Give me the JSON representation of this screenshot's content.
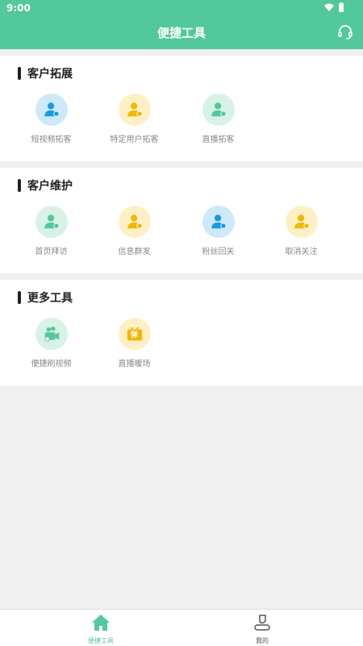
{
  "status_bar": {
    "time": "9:00"
  },
  "header": {
    "title": "便捷工具"
  },
  "sections": [
    {
      "title": "客户拓展",
      "items": [
        {
          "label": "短视频拓客",
          "icon": "user-video-icon",
          "color": "#1a9be0",
          "bg": "#cfe9f8"
        },
        {
          "label": "特定用户拓客",
          "icon": "user-search-icon",
          "color": "#f2b705",
          "bg": "#fdf0c4"
        },
        {
          "label": "直播拓客",
          "icon": "user-live-icon",
          "color": "#52c89c",
          "bg": "#d8f2e8"
        }
      ]
    },
    {
      "title": "客户维护",
      "items": [
        {
          "label": "首页拜访",
          "icon": "user-home-icon",
          "color": "#52c89c",
          "bg": "#d8f2e8"
        },
        {
          "label": "信息群发",
          "icon": "user-message-icon",
          "color": "#f2b705",
          "bg": "#fdf0c4"
        },
        {
          "label": "粉丝回关",
          "icon": "user-follow-icon",
          "color": "#1a9be0",
          "bg": "#cfe9f8"
        },
        {
          "label": "取消关注",
          "icon": "user-unfollow-icon",
          "color": "#f2b705",
          "bg": "#fdf0c4"
        }
      ]
    },
    {
      "title": "更多工具",
      "items": [
        {
          "label": "便捷刷视频",
          "icon": "video-camera-icon",
          "color": "#52c89c",
          "bg": "#d8f2e8"
        },
        {
          "label": "直播暖场",
          "icon": "tv-danmu-icon",
          "color": "#f2b705",
          "bg": "#fdf0c4",
          "glyph": "弹"
        }
      ]
    }
  ],
  "bottom_nav": [
    {
      "label": "便捷工具",
      "icon": "home-icon",
      "active": true,
      "color": "#52c89c"
    },
    {
      "label": "我的",
      "icon": "profile-icon",
      "active": false,
      "color": "#555555"
    }
  ]
}
